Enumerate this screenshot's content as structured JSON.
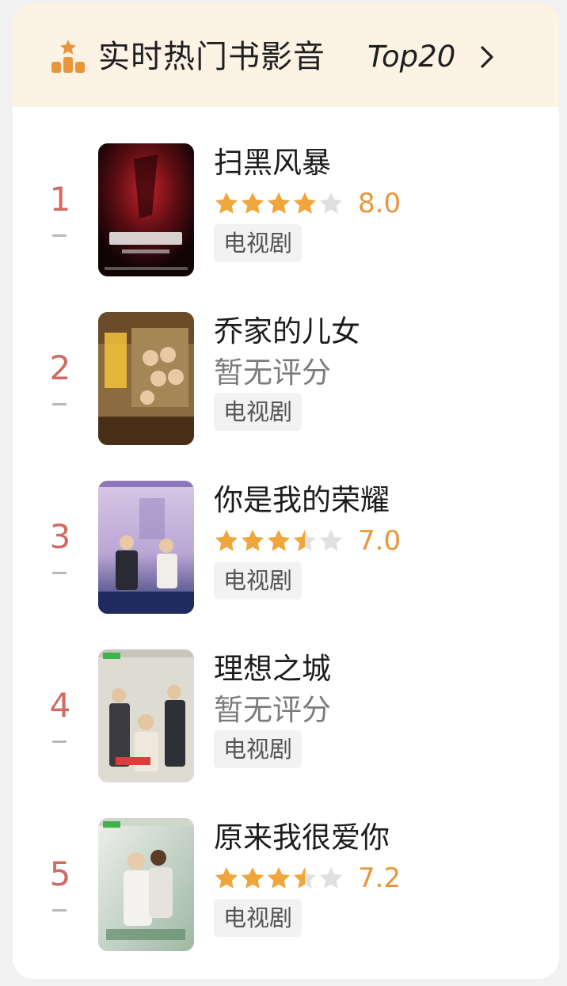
{
  "header": {
    "title": "实时热门书影音",
    "top_label": "Top20",
    "icon": "podium-star-icon",
    "chevron": "chevron-right-icon",
    "background": "#fdf3e4"
  },
  "colors": {
    "rank": "#d16a62",
    "star_filled": "#f0a63a",
    "star_empty": "#e0e0e0",
    "score": "#e9963a"
  },
  "items": [
    {
      "rank": "1",
      "title": "扫黑风暴",
      "has_rating": true,
      "rating": 4,
      "score": "8.0",
      "no_rating_text": "",
      "tag": "电视剧",
      "poster_icon": "poster-image"
    },
    {
      "rank": "2",
      "title": "乔家的儿女",
      "has_rating": false,
      "rating": 0,
      "score": "",
      "no_rating_text": "暂无评分",
      "tag": "电视剧",
      "poster_icon": "poster-image"
    },
    {
      "rank": "3",
      "title": "你是我的荣耀",
      "has_rating": true,
      "rating": 3.5,
      "score": "7.0",
      "no_rating_text": "",
      "tag": "电视剧",
      "poster_icon": "poster-image"
    },
    {
      "rank": "4",
      "title": "理想之城",
      "has_rating": false,
      "rating": 0,
      "score": "",
      "no_rating_text": "暂无评分",
      "tag": "电视剧",
      "poster_icon": "poster-image"
    },
    {
      "rank": "5",
      "title": "原来我很爱你",
      "has_rating": true,
      "rating": 3.5,
      "score": "7.2",
      "no_rating_text": "",
      "tag": "电视剧",
      "poster_icon": "poster-image"
    }
  ]
}
